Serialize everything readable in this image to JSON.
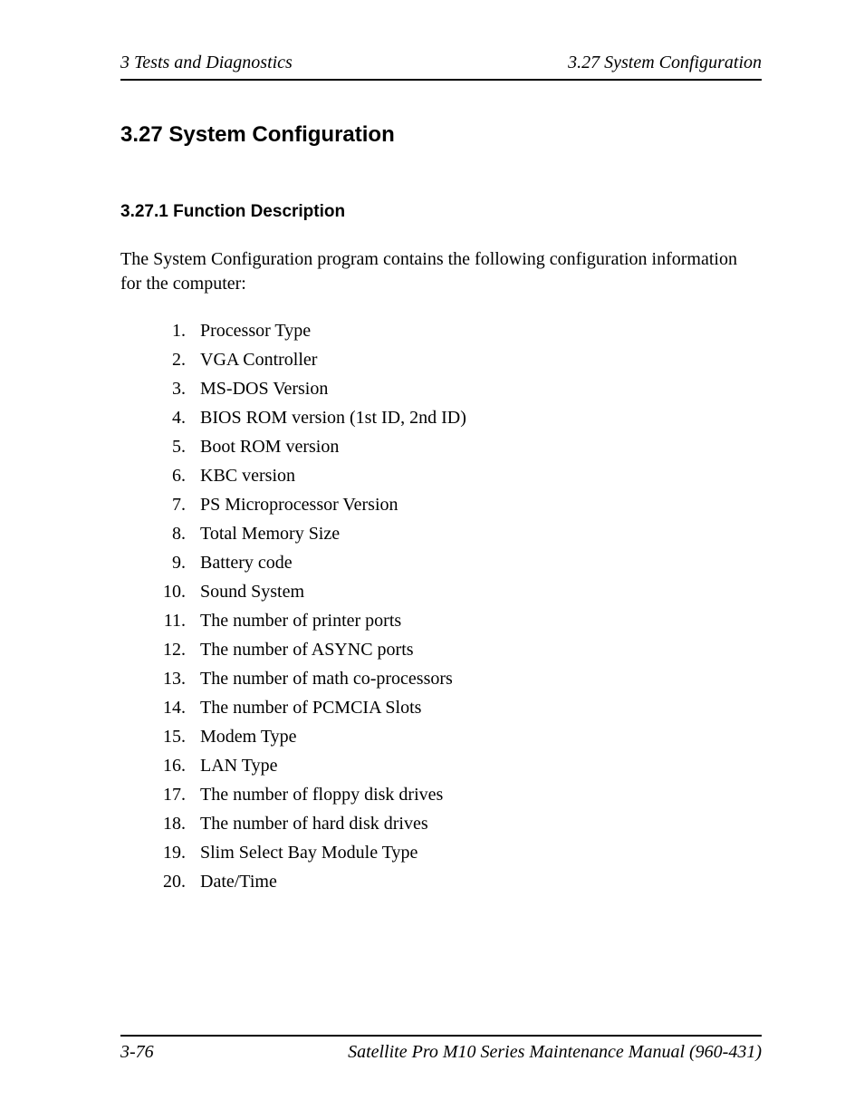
{
  "header": {
    "left": "3  Tests and Diagnostics",
    "right": "3.27  System Configuration"
  },
  "section_title": "3.27  System Configuration",
  "subsection_title": "3.27.1 Function Description",
  "intro": "The System Configuration program contains the following configuration information for the computer:",
  "items": [
    "Processor Type",
    "VGA Controller",
    "MS-DOS Version",
    "BIOS ROM version (1st ID, 2nd ID)",
    "Boot ROM version",
    "KBC version",
    "PS Microprocessor Version",
    "Total Memory Size",
    "Battery code",
    "Sound System",
    "The number of printer ports",
    "The number of ASYNC ports",
    "The number of math co-processors",
    "The number of PCMCIA Slots",
    "Modem Type",
    "LAN Type",
    "The number of floppy disk drives",
    "The number of hard disk drives",
    "Slim Select Bay Module Type",
    "Date/Time"
  ],
  "footer": {
    "left": "3-76",
    "right": "Satellite Pro M10 Series Maintenance Manual (960-431)"
  }
}
